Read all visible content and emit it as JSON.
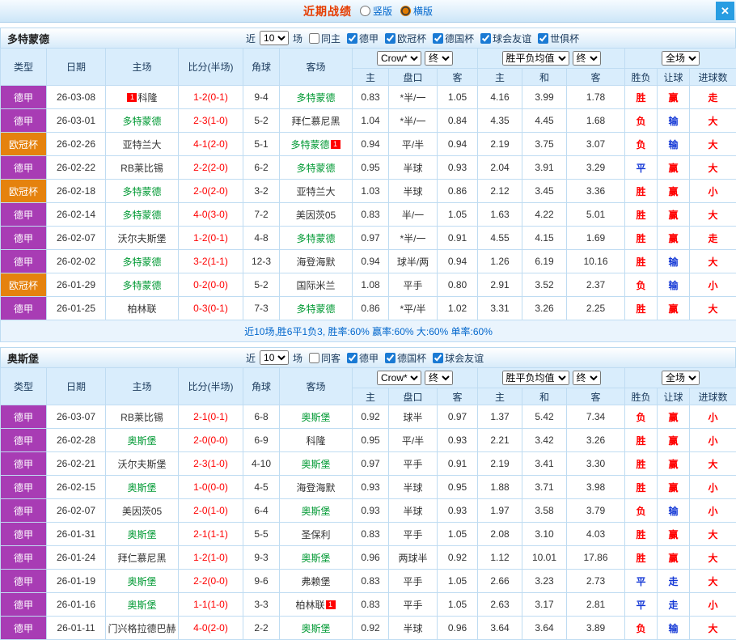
{
  "titlebar": {
    "title": "近期战绩",
    "layout_options": [
      {
        "label": "竖版",
        "selected": false
      },
      {
        "label": "横版",
        "selected": true
      }
    ],
    "close": "✕"
  },
  "league_colors": {
    "德甲": "#a83cb4",
    "欧冠杯": "#e5820e"
  },
  "result_colors": {
    "red": "#ff0000",
    "blue": "#1539d6"
  },
  "team_colors": {
    "focus": "#009933",
    "normal": "#333333"
  },
  "sections": [
    {
      "team": "多特蒙德",
      "filters": {
        "near": "近",
        "value": "10",
        "games": "场",
        "checks": [
          {
            "label": "同主",
            "checked": false
          },
          {
            "label": "德甲",
            "checked": true
          },
          {
            "label": "欧冠杯",
            "checked": true
          },
          {
            "label": "德国杯",
            "checked": true
          },
          {
            "label": "球会友谊",
            "checked": true
          },
          {
            "label": "世俱杯",
            "checked": true
          }
        ]
      },
      "columns": {
        "type": "类型",
        "date": "日期",
        "home": "主场",
        "score": "比分(半场)",
        "corner": "角球",
        "away": "客场",
        "odds_select": "Crow*",
        "odds_final": "终",
        "odds_sub": [
          "主",
          "盘口",
          "客"
        ],
        "avg_select": "胜平负均值",
        "avg_final": "终",
        "avg_sub": [
          "主",
          "和",
          "客"
        ],
        "scope_select": "全场",
        "result_sub": [
          "胜负",
          "让球",
          "进球数"
        ]
      },
      "rows": [
        {
          "league": "德甲",
          "date": "26-03-08",
          "home": {
            "name": "科隆",
            "green": false,
            "badge": "1",
            "badge_side": "left"
          },
          "score": "1-2(0-1)",
          "corner": "9-4",
          "away": {
            "name": "多特蒙德",
            "green": true
          },
          "odds": [
            "0.83",
            "*半/一",
            "1.05"
          ],
          "avg": [
            "4.16",
            "3.99",
            "1.78"
          ],
          "result": [
            [
              "胜",
              "red"
            ],
            [
              "赢",
              "red"
            ],
            [
              "走",
              "red"
            ]
          ]
        },
        {
          "league": "德甲",
          "date": "26-03-01",
          "home": {
            "name": "多特蒙德",
            "green": true
          },
          "score": "2-3(1-0)",
          "corner": "5-2",
          "away": {
            "name": "拜仁慕尼黑",
            "green": false
          },
          "odds": [
            "1.04",
            "*半/一",
            "0.84"
          ],
          "avg": [
            "4.35",
            "4.45",
            "1.68"
          ],
          "result": [
            [
              "负",
              "red"
            ],
            [
              "输",
              "blue"
            ],
            [
              "大",
              "red"
            ]
          ]
        },
        {
          "league": "欧冠杯",
          "date": "26-02-26",
          "home": {
            "name": "亚特兰大",
            "green": false
          },
          "score": "4-1(2-0)",
          "corner": "5-1",
          "away": {
            "name": "多特蒙德",
            "green": true,
            "badge": "1",
            "badge_side": "right"
          },
          "odds": [
            "0.94",
            "平/半",
            "0.94"
          ],
          "avg": [
            "2.19",
            "3.75",
            "3.07"
          ],
          "result": [
            [
              "负",
              "red"
            ],
            [
              "输",
              "blue"
            ],
            [
              "大",
              "red"
            ]
          ]
        },
        {
          "league": "德甲",
          "date": "26-02-22",
          "home": {
            "name": "RB莱比锡",
            "green": false
          },
          "score": "2-2(2-0)",
          "corner": "6-2",
          "away": {
            "name": "多特蒙德",
            "green": true
          },
          "odds": [
            "0.95",
            "半球",
            "0.93"
          ],
          "avg": [
            "2.04",
            "3.91",
            "3.29"
          ],
          "result": [
            [
              "平",
              "blue"
            ],
            [
              "赢",
              "red"
            ],
            [
              "大",
              "red"
            ]
          ]
        },
        {
          "league": "欧冠杯",
          "date": "26-02-18",
          "home": {
            "name": "多特蒙德",
            "green": true
          },
          "score": "2-0(2-0)",
          "corner": "3-2",
          "away": {
            "name": "亚特兰大",
            "green": false
          },
          "odds": [
            "1.03",
            "半球",
            "0.86"
          ],
          "avg": [
            "2.12",
            "3.45",
            "3.36"
          ],
          "result": [
            [
              "胜",
              "red"
            ],
            [
              "赢",
              "red"
            ],
            [
              "小",
              "red"
            ]
          ]
        },
        {
          "league": "德甲",
          "date": "26-02-14",
          "home": {
            "name": "多特蒙德",
            "green": true
          },
          "score": "4-0(3-0)",
          "corner": "7-2",
          "away": {
            "name": "美因茨05",
            "green": false
          },
          "odds": [
            "0.83",
            "半/一",
            "1.05"
          ],
          "avg": [
            "1.63",
            "4.22",
            "5.01"
          ],
          "result": [
            [
              "胜",
              "red"
            ],
            [
              "赢",
              "red"
            ],
            [
              "大",
              "red"
            ]
          ]
        },
        {
          "league": "德甲",
          "date": "26-02-07",
          "home": {
            "name": "沃尔夫斯堡",
            "green": false
          },
          "score": "1-2(0-1)",
          "corner": "4-8",
          "away": {
            "name": "多特蒙德",
            "green": true
          },
          "odds": [
            "0.97",
            "*半/一",
            "0.91"
          ],
          "avg": [
            "4.55",
            "4.15",
            "1.69"
          ],
          "result": [
            [
              "胜",
              "red"
            ],
            [
              "赢",
              "red"
            ],
            [
              "走",
              "red"
            ]
          ]
        },
        {
          "league": "德甲",
          "date": "26-02-02",
          "home": {
            "name": "多特蒙德",
            "green": true
          },
          "score": "3-2(1-1)",
          "corner": "12-3",
          "away": {
            "name": "海登海默",
            "green": false
          },
          "odds": [
            "0.94",
            "球半/两",
            "0.94"
          ],
          "avg": [
            "1.26",
            "6.19",
            "10.16"
          ],
          "result": [
            [
              "胜",
              "red"
            ],
            [
              "输",
              "blue"
            ],
            [
              "大",
              "red"
            ]
          ]
        },
        {
          "league": "欧冠杯",
          "date": "26-01-29",
          "home": {
            "name": "多特蒙德",
            "green": true
          },
          "score": "0-2(0-0)",
          "corner": "5-2",
          "away": {
            "name": "国际米兰",
            "green": false
          },
          "odds": [
            "1.08",
            "平手",
            "0.80"
          ],
          "avg": [
            "2.91",
            "3.52",
            "2.37"
          ],
          "result": [
            [
              "负",
              "red"
            ],
            [
              "输",
              "blue"
            ],
            [
              "小",
              "red"
            ]
          ]
        },
        {
          "league": "德甲",
          "date": "26-01-25",
          "home": {
            "name": "柏林联",
            "green": false
          },
          "score": "0-3(0-1)",
          "corner": "7-3",
          "away": {
            "name": "多特蒙德",
            "green": true
          },
          "odds": [
            "0.86",
            "*平/半",
            "1.02"
          ],
          "avg": [
            "3.31",
            "3.26",
            "2.25"
          ],
          "result": [
            [
              "胜",
              "red"
            ],
            [
              "赢",
              "red"
            ],
            [
              "大",
              "red"
            ]
          ]
        }
      ],
      "summary": "近10场,胜6平1负3, 胜率:60% 赢率:60% 大:60% 单率:60%"
    },
    {
      "team": "奥斯堡",
      "filters": {
        "near": "近",
        "value": "10",
        "games": "场",
        "checks": [
          {
            "label": "同客",
            "checked": false
          },
          {
            "label": "德甲",
            "checked": true
          },
          {
            "label": "德国杯",
            "checked": true
          },
          {
            "label": "球会友谊",
            "checked": true
          }
        ]
      },
      "columns": {
        "type": "类型",
        "date": "日期",
        "home": "主场",
        "score": "比分(半场)",
        "corner": "角球",
        "away": "客场",
        "odds_select": "Crow*",
        "odds_final": "终",
        "odds_sub": [
          "主",
          "盘口",
          "客"
        ],
        "avg_select": "胜平负均值",
        "avg_final": "终",
        "avg_sub": [
          "主",
          "和",
          "客"
        ],
        "scope_select": "全场",
        "result_sub": [
          "胜负",
          "让球",
          "进球数"
        ]
      },
      "rows": [
        {
          "league": "德甲",
          "date": "26-03-07",
          "home": {
            "name": "RB莱比锡",
            "green": false
          },
          "score": "2-1(0-1)",
          "corner": "6-8",
          "away": {
            "name": "奥斯堡",
            "green": true
          },
          "odds": [
            "0.92",
            "球半",
            "0.97"
          ],
          "avg": [
            "1.37",
            "5.42",
            "7.34"
          ],
          "result": [
            [
              "负",
              "red"
            ],
            [
              "赢",
              "red"
            ],
            [
              "小",
              "red"
            ]
          ]
        },
        {
          "league": "德甲",
          "date": "26-02-28",
          "home": {
            "name": "奥斯堡",
            "green": true
          },
          "score": "2-0(0-0)",
          "corner": "6-9",
          "away": {
            "name": "科隆",
            "green": false
          },
          "odds": [
            "0.95",
            "平/半",
            "0.93"
          ],
          "avg": [
            "2.21",
            "3.42",
            "3.26"
          ],
          "result": [
            [
              "胜",
              "red"
            ],
            [
              "赢",
              "red"
            ],
            [
              "小",
              "red"
            ]
          ]
        },
        {
          "league": "德甲",
          "date": "26-02-21",
          "home": {
            "name": "沃尔夫斯堡",
            "green": false
          },
          "score": "2-3(1-0)",
          "corner": "4-10",
          "away": {
            "name": "奥斯堡",
            "green": true
          },
          "odds": [
            "0.97",
            "平手",
            "0.91"
          ],
          "avg": [
            "2.19",
            "3.41",
            "3.30"
          ],
          "result": [
            [
              "胜",
              "red"
            ],
            [
              "赢",
              "red"
            ],
            [
              "大",
              "red"
            ]
          ]
        },
        {
          "league": "德甲",
          "date": "26-02-15",
          "home": {
            "name": "奥斯堡",
            "green": true
          },
          "score": "1-0(0-0)",
          "corner": "4-5",
          "away": {
            "name": "海登海默",
            "green": false
          },
          "odds": [
            "0.93",
            "半球",
            "0.95"
          ],
          "avg": [
            "1.88",
            "3.71",
            "3.98"
          ],
          "result": [
            [
              "胜",
              "red"
            ],
            [
              "赢",
              "red"
            ],
            [
              "小",
              "red"
            ]
          ]
        },
        {
          "league": "德甲",
          "date": "26-02-07",
          "home": {
            "name": "美因茨05",
            "green": false
          },
          "score": "2-0(1-0)",
          "corner": "6-4",
          "away": {
            "name": "奥斯堡",
            "green": true
          },
          "odds": [
            "0.93",
            "半球",
            "0.93"
          ],
          "avg": [
            "1.97",
            "3.58",
            "3.79"
          ],
          "result": [
            [
              "负",
              "red"
            ],
            [
              "输",
              "blue"
            ],
            [
              "小",
              "red"
            ]
          ]
        },
        {
          "league": "德甲",
          "date": "26-01-31",
          "home": {
            "name": "奥斯堡",
            "green": true
          },
          "score": "2-1(1-1)",
          "corner": "5-5",
          "away": {
            "name": "圣保利",
            "green": false
          },
          "odds": [
            "0.83",
            "平手",
            "1.05"
          ],
          "avg": [
            "2.08",
            "3.10",
            "4.03"
          ],
          "result": [
            [
              "胜",
              "red"
            ],
            [
              "赢",
              "red"
            ],
            [
              "大",
              "red"
            ]
          ]
        },
        {
          "league": "德甲",
          "date": "26-01-24",
          "home": {
            "name": "拜仁慕尼黑",
            "green": false
          },
          "score": "1-2(1-0)",
          "corner": "9-3",
          "away": {
            "name": "奥斯堡",
            "green": true
          },
          "odds": [
            "0.96",
            "两球半",
            "0.92"
          ],
          "avg": [
            "1.12",
            "10.01",
            "17.86"
          ],
          "result": [
            [
              "胜",
              "red"
            ],
            [
              "赢",
              "red"
            ],
            [
              "大",
              "red"
            ]
          ]
        },
        {
          "league": "德甲",
          "date": "26-01-19",
          "home": {
            "name": "奥斯堡",
            "green": true
          },
          "score": "2-2(0-0)",
          "corner": "9-6",
          "away": {
            "name": "弗赖堡",
            "green": false
          },
          "odds": [
            "0.83",
            "平手",
            "1.05"
          ],
          "avg": [
            "2.66",
            "3.23",
            "2.73"
          ],
          "result": [
            [
              "平",
              "blue"
            ],
            [
              "走",
              "blue"
            ],
            [
              "大",
              "red"
            ]
          ]
        },
        {
          "league": "德甲",
          "date": "26-01-16",
          "home": {
            "name": "奥斯堡",
            "green": true
          },
          "score": "1-1(1-0)",
          "corner": "3-3",
          "away": {
            "name": "柏林联",
            "green": false,
            "badge": "1",
            "badge_side": "right"
          },
          "odds": [
            "0.83",
            "平手",
            "1.05"
          ],
          "avg": [
            "2.63",
            "3.17",
            "2.81"
          ],
          "result": [
            [
              "平",
              "blue"
            ],
            [
              "走",
              "blue"
            ],
            [
              "小",
              "red"
            ]
          ]
        },
        {
          "league": "德甲",
          "date": "26-01-11",
          "home": {
            "name": "门兴格拉德巴赫",
            "green": false
          },
          "score": "4-0(2-0)",
          "corner": "2-2",
          "away": {
            "name": "奥斯堡",
            "green": true
          },
          "odds": [
            "0.92",
            "半球",
            "0.96"
          ],
          "avg": [
            "3.64",
            "3.64",
            "3.89"
          ],
          "result": [
            [
              "负",
              "red"
            ],
            [
              "输",
              "blue"
            ],
            [
              "大",
              "red"
            ]
          ]
        }
      ]
    }
  ]
}
